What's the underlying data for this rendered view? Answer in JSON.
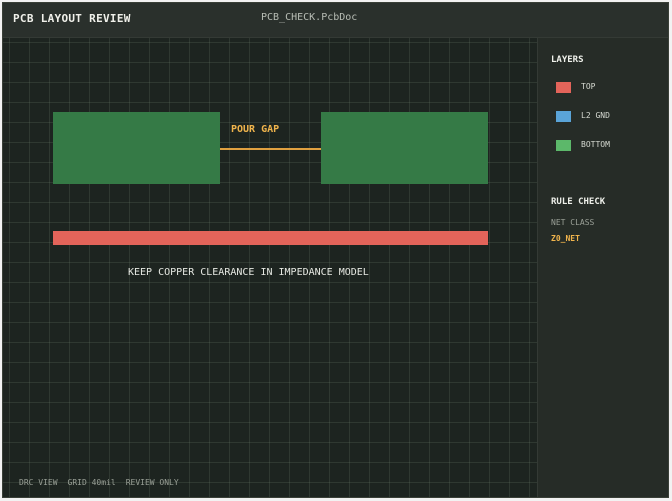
{
  "header": {
    "app_title": "PCB LAYOUT REVIEW",
    "document": "PCB_CHECK.PcbDoc"
  },
  "canvas": {
    "gap_label": "POUR GAP",
    "note": "KEEP COPPER CLEARANCE IN IMPEDANCE MODEL",
    "copper_color": "#357a46",
    "trace_color": "#e3645a",
    "gap_color": "#e0a040"
  },
  "footer": {
    "items": [
      "DRC VIEW",
      "GRID 40mil",
      "REVIEW ONLY"
    ]
  },
  "sidebar": {
    "layers_heading": "LAYERS",
    "layers": [
      {
        "label": "TOP",
        "color": "#e3645a"
      },
      {
        "label": "L2 GND",
        "color": "#5aa4d8"
      },
      {
        "label": "BOTTOM",
        "color": "#5cb86a"
      }
    ],
    "rule_heading": "RULE CHECK",
    "net_class_label": "NET CLASS",
    "net_class_value": "Z0_NET"
  }
}
